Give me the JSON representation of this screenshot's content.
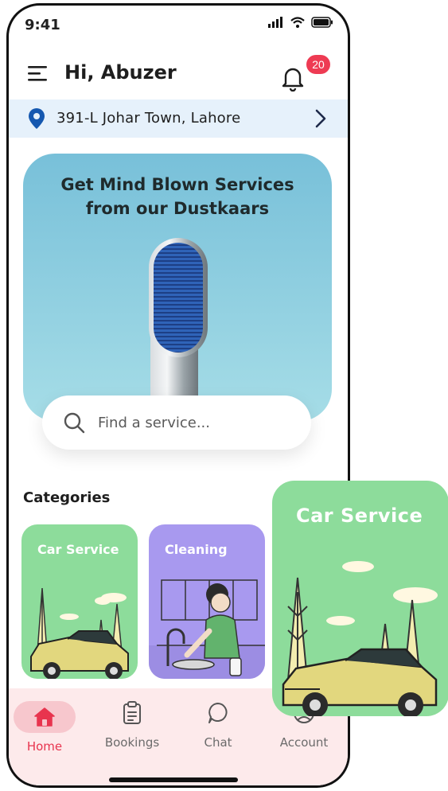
{
  "status_bar": {
    "time": "9:41"
  },
  "header": {
    "greeting": "Hi, Abuzer",
    "notification_count": "20"
  },
  "location": {
    "address": "391-L Johar Town, Lahore"
  },
  "hero": {
    "title_line1": "Get Mind Blown Services",
    "title_line2": "from our Dustkaars"
  },
  "search": {
    "placeholder": "Find a service..."
  },
  "categories": {
    "title": "Categories",
    "items": [
      {
        "label": "Car Service"
      },
      {
        "label": "Cleaning"
      }
    ]
  },
  "bottom_nav": {
    "items": [
      {
        "label": "Home",
        "icon": "home-icon",
        "active": true
      },
      {
        "label": "Bookings",
        "icon": "clipboard-icon"
      },
      {
        "label": "Chat",
        "icon": "chat-icon"
      },
      {
        "label": "Account",
        "icon": "account-icon"
      }
    ]
  },
  "floating_card": {
    "label": "Car Service"
  },
  "colors": {
    "accent": "#ee3b53",
    "location_bg": "#e6f1fb",
    "car_card": "#8ddc9b",
    "cleaning_card": "#a899ef",
    "nav_bg": "#fdeaeb"
  }
}
